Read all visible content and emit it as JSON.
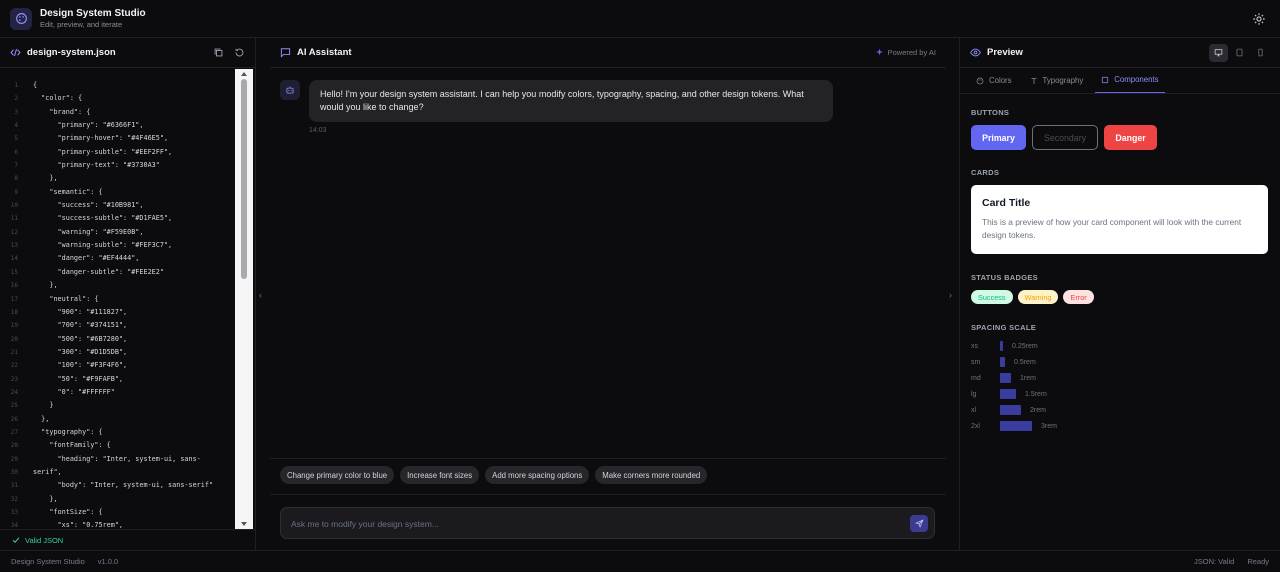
{
  "app": {
    "title": "Design System Studio",
    "subtitle": "Edit, preview, and iterate"
  },
  "editor": {
    "filename": "design-system.json",
    "line_numbers": [
      "1",
      "2",
      "3",
      "4",
      "5",
      "6",
      "7",
      "8",
      "9",
      "10",
      "11",
      "12",
      "13",
      "14",
      "15",
      "16",
      "17",
      "18",
      "19",
      "20",
      "21",
      "22",
      "23",
      "24",
      "25",
      "26",
      "27",
      "28",
      "29",
      "30",
      "31",
      "32",
      "33",
      "34"
    ],
    "lines": [
      "{",
      "  \"color\": {",
      "    \"brand\": {",
      "      \"primary\": \"#6366F1\",",
      "      \"primary-hover\": \"#4F46E5\",",
      "      \"primary-subtle\": \"#EEF2FF\",",
      "      \"primary-text\": \"#3730A3\"",
      "    },",
      "    \"semantic\": {",
      "      \"success\": \"#10B981\",",
      "      \"success-subtle\": \"#D1FAE5\",",
      "      \"warning\": \"#F59E0B\",",
      "      \"warning-subtle\": \"#FEF3C7\",",
      "      \"danger\": \"#EF4444\",",
      "      \"danger-subtle\": \"#FEE2E2\"",
      "    },",
      "    \"neutral\": {",
      "      \"900\": \"#111827\",",
      "      \"700\": \"#374151\",",
      "      \"500\": \"#6B7280\",",
      "      \"300\": \"#D1D5DB\",",
      "      \"100\": \"#F3F4F6\",",
      "      \"50\": \"#F9FAFB\",",
      "      \"0\": \"#FFFFFF\"",
      "    }",
      "  },",
      "  \"typography\": {",
      "    \"fontFamily\": {",
      "      \"heading\": \"Inter, system-ui, sans-",
      "serif\",",
      "      \"body\": \"Inter, system-ui, sans-serif\"",
      "    },",
      "    \"fontSize\": {",
      "      \"xs\": \"0.75rem\","
    ],
    "status": "Valid JSON"
  },
  "chat": {
    "title": "AI Assistant",
    "powered_by": "Powered by AI",
    "message": "Hello! I'm your design system assistant. I can help you modify colors, typography, spacing, and other design tokens. What would you like to change?",
    "time": "14:03",
    "suggestions": [
      "Change primary color to blue",
      "Increase font sizes",
      "Add more spacing options",
      "Make corners more rounded"
    ],
    "input_placeholder": "Ask me to modify your design system..."
  },
  "preview": {
    "title": "Preview",
    "tabs": [
      "Colors",
      "Typography",
      "Components"
    ],
    "active_tab": "Components",
    "buttons_label": "BUTTONS",
    "buttons": [
      "Primary",
      "Secondary",
      "Danger"
    ],
    "cards_label": "CARDS",
    "card_title": "Card Title",
    "card_body": "This is a preview of how your card component will look with the current design tokens.",
    "badges_label": "STATUS BADGES",
    "badges": [
      "Success",
      "Warning",
      "Error"
    ],
    "spacing_label": "SPACING SCALE",
    "spacing": [
      {
        "key": "xs",
        "value": "0.25rem",
        "rem": 0.25
      },
      {
        "key": "sm",
        "value": "0.5rem",
        "rem": 0.5
      },
      {
        "key": "md",
        "value": "1rem",
        "rem": 1
      },
      {
        "key": "lg",
        "value": "1.5rem",
        "rem": 1.5
      },
      {
        "key": "xl",
        "value": "2rem",
        "rem": 2
      },
      {
        "key": "2xl",
        "value": "3rem",
        "rem": 3
      }
    ]
  },
  "statusbar": {
    "app_name": "Design System Studio",
    "version": "v1.0.0",
    "json_status": "JSON: Valid",
    "ready": "Ready"
  },
  "colors": {
    "primary": "#6366F1",
    "danger": "#EF4444",
    "success": "#10B981"
  }
}
